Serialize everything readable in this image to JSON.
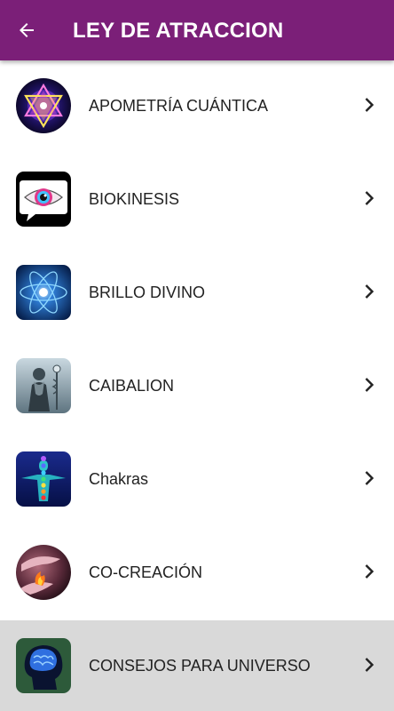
{
  "toolbar": {
    "title": "LEY DE ATRACCION",
    "back_icon": "arrow-left-icon",
    "background": "#7b1f78"
  },
  "list": {
    "items": [
      {
        "label": "APOMETRÍA CUÁNTICA",
        "icon": "merkaba-icon"
      },
      {
        "label": "BIOKINESIS",
        "icon": "eye-icon"
      },
      {
        "label": "BRILLO DIVINO",
        "icon": "atom-icon"
      },
      {
        "label": "CAIBALION",
        "icon": "hermes-icon"
      },
      {
        "label": "Chakras",
        "icon": "chakras-icon"
      },
      {
        "label": "CO-CREACIÓN",
        "icon": "cocreation-icon"
      },
      {
        "label": "CONSEJOS PARA UNIVERSO",
        "icon": "brain-icon",
        "pressed": true
      }
    ],
    "chevron_icon": "chevron-right-icon",
    "pressed_color": "#d9d9d9"
  }
}
